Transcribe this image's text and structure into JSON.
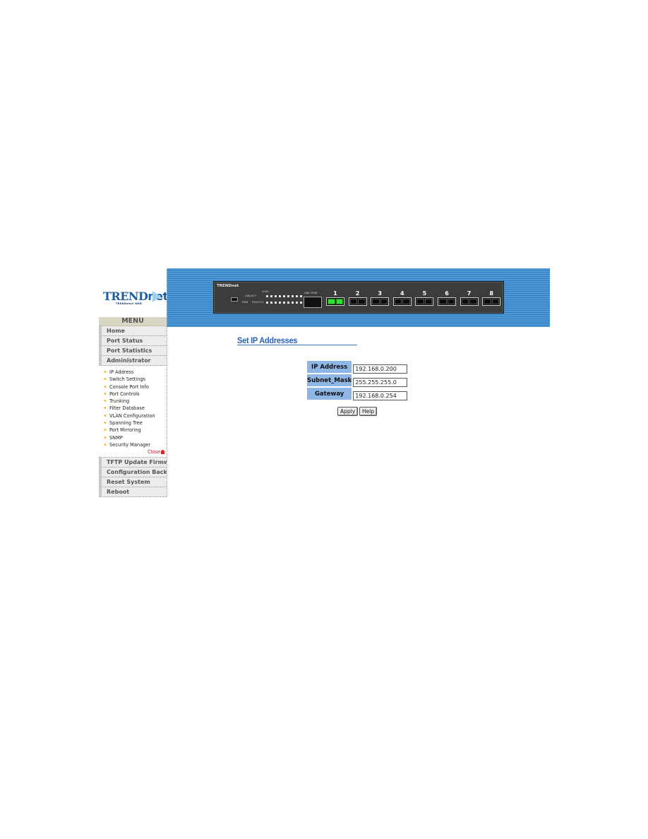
{
  "logo": {
    "brand": "TREND",
    "brand_suffix": "net",
    "tagline": "TRENDware WEB"
  },
  "banner": {
    "panel_brand": "TRENDnet",
    "led_labels": {
      "speed": "1000",
      "link": "LNK/ACT",
      "power": "PWR",
      "duplex": "FDX/COL"
    },
    "gbic_label": "GBIC PORT",
    "ports": [
      {
        "number": "1",
        "active": true
      },
      {
        "number": "2",
        "active": false
      },
      {
        "number": "3",
        "active": false
      },
      {
        "number": "4",
        "active": false
      },
      {
        "number": "5",
        "active": false
      },
      {
        "number": "6",
        "active": false
      },
      {
        "number": "7",
        "active": false
      },
      {
        "number": "8",
        "active": false
      }
    ]
  },
  "menu": {
    "header": "MENU",
    "items_top": [
      "Home",
      "Port Status",
      "Port Statistics",
      "Administrator"
    ],
    "admin_subitems": [
      "IP Address",
      "Switch Settings",
      "Console Port Info",
      "Port Controls",
      "Trunking",
      "Filter Database",
      "VLAN Configuration",
      "Spanning Tree",
      "Port Mirroring",
      "SNMP",
      "Security Manager"
    ],
    "close_label": "Close",
    "items_bottom": [
      "TFTP Update Firmware",
      "Configuration Backup",
      "Reset System",
      "Reboot"
    ]
  },
  "content": {
    "title": "Set IP Addresses",
    "fields": [
      {
        "label": "IP Address",
        "value": "192.168.0.200"
      },
      {
        "label": "Subnet_Mask",
        "value": "255.255.255.0"
      },
      {
        "label": "Gateway",
        "value": "192.168.0.254"
      }
    ],
    "apply_label": "Apply",
    "help_label": "Help"
  },
  "colors": {
    "banner_blue": "#4f9ad6",
    "title_blue": "#2b62b6",
    "label_bg": "#8fb7e6",
    "port_active": "#2fe22f"
  }
}
